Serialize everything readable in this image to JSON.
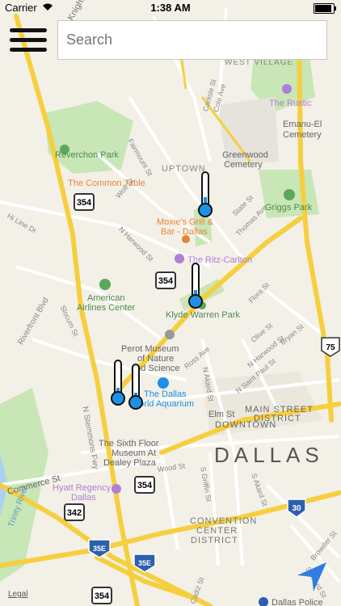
{
  "status": {
    "carrier": "Carrier",
    "time": "1:38 AM"
  },
  "search": {
    "placeholder": "Search"
  },
  "map": {
    "labels": {
      "knight_st": "Knight St",
      "west_village": "WEST VILLAGE",
      "the_rustic": "The Rustic",
      "emanu_el": "Emanu-El",
      "cemetery": "Cemetery",
      "reverchon_park": "Reverchon Park",
      "fairmount_st": "Fairmount St",
      "carlisle_st": "Carlisle St",
      "cole_ave": "Cole Ave",
      "greenwood": "Greenwood",
      "greenwood_cemetery": "Cemetery",
      "uptown": "UPTOWN",
      "the_common_table": "The Common Table",
      "griggs_park": "Griggs Park",
      "wolf_st": "Wolf St",
      "state_st": "State St",
      "thomas_ave": "Thomas Ave",
      "moxies_1": "Moxie's Grill &",
      "moxies_2": "Bar - Dallas",
      "hi_line_dr": "Hi Line Dr",
      "n_harwood_st": "N Harwood St",
      "ritz": "The Ritz-Carlton",
      "american_1": "American",
      "american_2": "Airlines Center",
      "klyde": "Klyde Warren Park",
      "flora_st": "Flora St",
      "riverfront": "Riverfront Blvd",
      "slocum_st": "Slocum St",
      "perot_1": "Perot Museum",
      "perot_2": "of Nature",
      "perot_3": "and Science",
      "olive_st": "Olive St",
      "bryan_st": "Bryan St",
      "n_harwood_st2": "N Harwood St",
      "n_saint_paul": "N Saint Paul St",
      "n_akard_st": "N Akard St",
      "ross_ave": "Ross Ave",
      "aquarium_1": "The Dallas",
      "aquarium_2": "World Aquarium",
      "n_stemmons": "N Stemmons Fwy",
      "elm_st": "Elm St",
      "main_street": "MAIN STREET",
      "district": "DISTRICT",
      "downtown": "DOWNTOWN",
      "sixth_floor_1": "The Sixth Floor",
      "sixth_floor_2": "Museum At",
      "sixth_floor_3": "Dealey Plaza",
      "dallas": "DALLAS",
      "commerce_st": "Commerce St",
      "wood_st": "Wood St",
      "s_griffin": "S Griffin St",
      "s_akard": "S Akard St",
      "hyatt_1": "Hyatt Regency",
      "hyatt_2": "Dallas",
      "trinity_river": "Trinity River",
      "convention_1": "CONVENTION",
      "convention_2": "CENTER",
      "convention_3": "DISTRICT",
      "cadiz_st": "Cadiz St",
      "browder_st": "Browder St",
      "s_akard2": "S Akard St",
      "dallas_police": "Dallas Police"
    },
    "shields": {
      "s354a": "354",
      "s354b": "354",
      "s354c": "354",
      "s342": "342",
      "s354d": "354",
      "s354e": "354",
      "i30": "30",
      "i35e_a": "35E",
      "i35e_b": "35E",
      "us75": "75"
    },
    "legal": "Legal"
  },
  "thermometers": [
    {
      "level": 0.3
    },
    {
      "level": 0.25
    },
    {
      "level": 0.22
    },
    {
      "level": 0.2
    }
  ],
  "colors": {
    "fill": "#1e90e6",
    "water": "#a8d3f0",
    "park": "#c6e6b4",
    "highway": "#f7d54a",
    "poi": "#e8843a",
    "hotel": "#b07fd6"
  },
  "icons": {
    "menu": "hamburger-icon",
    "location": "location-arrow-icon"
  }
}
